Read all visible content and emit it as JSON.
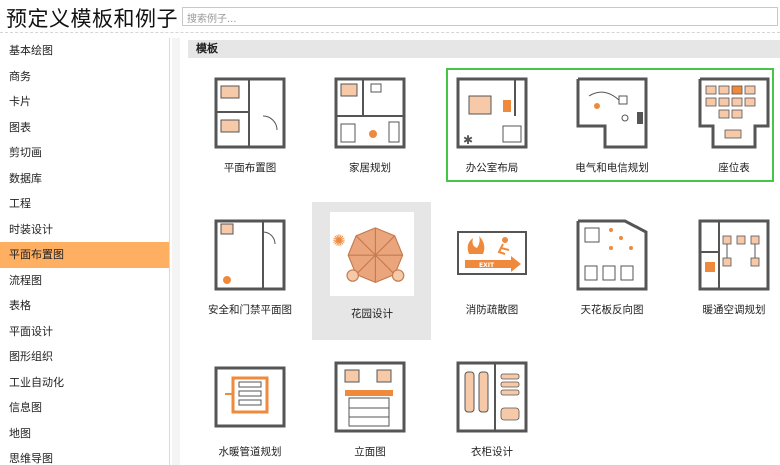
{
  "header": {
    "title": "预定义模板和例子",
    "search_placeholder": "搜索例子..."
  },
  "sidebar": {
    "items": [
      {
        "label": "基本绘图"
      },
      {
        "label": "商务"
      },
      {
        "label": "卡片"
      },
      {
        "label": "图表"
      },
      {
        "label": "剪切画"
      },
      {
        "label": "数据库"
      },
      {
        "label": "工程"
      },
      {
        "label": "时装设计"
      },
      {
        "label": "平面布置图",
        "selected": true
      },
      {
        "label": "流程图"
      },
      {
        "label": "表格"
      },
      {
        "label": "平面设计"
      },
      {
        "label": "图形组织"
      },
      {
        "label": "工业自动化"
      },
      {
        "label": "信息图"
      },
      {
        "label": "地图"
      },
      {
        "label": "思维导图"
      }
    ]
  },
  "main": {
    "section_title": "模板",
    "templates": [
      {
        "label": "平面布置图",
        "icon": "floor-plan-icon"
      },
      {
        "label": "家居规划",
        "icon": "home-plan-icon"
      },
      {
        "label": "办公室布局",
        "icon": "office-layout-icon"
      },
      {
        "label": "电气和电信规划",
        "icon": "electrical-plan-icon"
      },
      {
        "label": "座位表",
        "icon": "seating-chart-icon"
      },
      {
        "label": "安全和门禁平面图",
        "icon": "security-access-icon"
      },
      {
        "label": "花园设计",
        "icon": "garden-design-icon",
        "selected": true
      },
      {
        "label": "消防疏散图",
        "icon": "fire-escape-icon"
      },
      {
        "label": "天花板反向图",
        "icon": "reflected-ceiling-icon"
      },
      {
        "label": "暖通空调规划",
        "icon": "hvac-plan-icon"
      },
      {
        "label": "水暖管道规划",
        "icon": "plumbing-plan-icon"
      },
      {
        "label": "立面图",
        "icon": "elevation-icon"
      },
      {
        "label": "衣柜设计",
        "icon": "wardrobe-design-icon"
      }
    ],
    "exit_sign_text": "EXIT"
  },
  "colors": {
    "accent": "#ffaf61",
    "orange_icon": "#ef8a3c",
    "group_border": "#46c646",
    "wall": "#555555"
  }
}
